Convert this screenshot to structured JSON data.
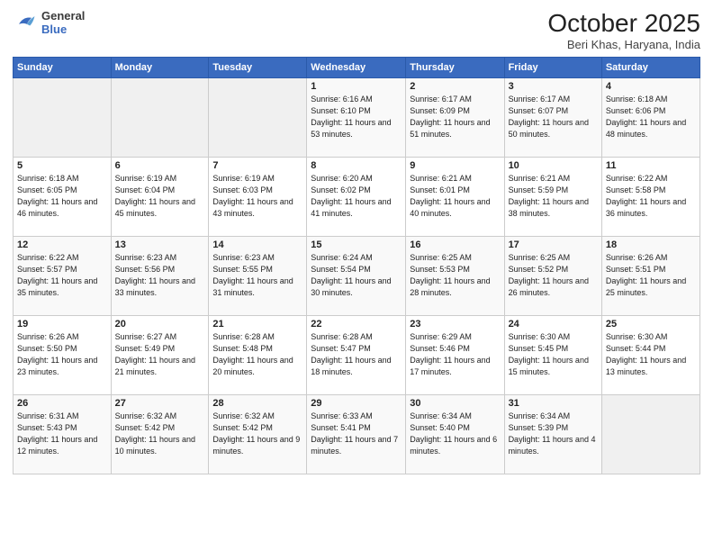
{
  "header": {
    "logo_line1": "General",
    "logo_line2": "Blue",
    "title": "October 2025",
    "location": "Beri Khas, Haryana, India"
  },
  "days": [
    "Sunday",
    "Monday",
    "Tuesday",
    "Wednesday",
    "Thursday",
    "Friday",
    "Saturday"
  ],
  "weeks": [
    [
      {
        "date": "",
        "sunrise": "",
        "sunset": "",
        "daylight": ""
      },
      {
        "date": "",
        "sunrise": "",
        "sunset": "",
        "daylight": ""
      },
      {
        "date": "",
        "sunrise": "",
        "sunset": "",
        "daylight": ""
      },
      {
        "date": "1",
        "sunrise": "Sunrise: 6:16 AM",
        "sunset": "Sunset: 6:10 PM",
        "daylight": "Daylight: 11 hours and 53 minutes."
      },
      {
        "date": "2",
        "sunrise": "Sunrise: 6:17 AM",
        "sunset": "Sunset: 6:09 PM",
        "daylight": "Daylight: 11 hours and 51 minutes."
      },
      {
        "date": "3",
        "sunrise": "Sunrise: 6:17 AM",
        "sunset": "Sunset: 6:07 PM",
        "daylight": "Daylight: 11 hours and 50 minutes."
      },
      {
        "date": "4",
        "sunrise": "Sunrise: 6:18 AM",
        "sunset": "Sunset: 6:06 PM",
        "daylight": "Daylight: 11 hours and 48 minutes."
      }
    ],
    [
      {
        "date": "5",
        "sunrise": "Sunrise: 6:18 AM",
        "sunset": "Sunset: 6:05 PM",
        "daylight": "Daylight: 11 hours and 46 minutes."
      },
      {
        "date": "6",
        "sunrise": "Sunrise: 6:19 AM",
        "sunset": "Sunset: 6:04 PM",
        "daylight": "Daylight: 11 hours and 45 minutes."
      },
      {
        "date": "7",
        "sunrise": "Sunrise: 6:19 AM",
        "sunset": "Sunset: 6:03 PM",
        "daylight": "Daylight: 11 hours and 43 minutes."
      },
      {
        "date": "8",
        "sunrise": "Sunrise: 6:20 AM",
        "sunset": "Sunset: 6:02 PM",
        "daylight": "Daylight: 11 hours and 41 minutes."
      },
      {
        "date": "9",
        "sunrise": "Sunrise: 6:21 AM",
        "sunset": "Sunset: 6:01 PM",
        "daylight": "Daylight: 11 hours and 40 minutes."
      },
      {
        "date": "10",
        "sunrise": "Sunrise: 6:21 AM",
        "sunset": "Sunset: 5:59 PM",
        "daylight": "Daylight: 11 hours and 38 minutes."
      },
      {
        "date": "11",
        "sunrise": "Sunrise: 6:22 AM",
        "sunset": "Sunset: 5:58 PM",
        "daylight": "Daylight: 11 hours and 36 minutes."
      }
    ],
    [
      {
        "date": "12",
        "sunrise": "Sunrise: 6:22 AM",
        "sunset": "Sunset: 5:57 PM",
        "daylight": "Daylight: 11 hours and 35 minutes."
      },
      {
        "date": "13",
        "sunrise": "Sunrise: 6:23 AM",
        "sunset": "Sunset: 5:56 PM",
        "daylight": "Daylight: 11 hours and 33 minutes."
      },
      {
        "date": "14",
        "sunrise": "Sunrise: 6:23 AM",
        "sunset": "Sunset: 5:55 PM",
        "daylight": "Daylight: 11 hours and 31 minutes."
      },
      {
        "date": "15",
        "sunrise": "Sunrise: 6:24 AM",
        "sunset": "Sunset: 5:54 PM",
        "daylight": "Daylight: 11 hours and 30 minutes."
      },
      {
        "date": "16",
        "sunrise": "Sunrise: 6:25 AM",
        "sunset": "Sunset: 5:53 PM",
        "daylight": "Daylight: 11 hours and 28 minutes."
      },
      {
        "date": "17",
        "sunrise": "Sunrise: 6:25 AM",
        "sunset": "Sunset: 5:52 PM",
        "daylight": "Daylight: 11 hours and 26 minutes."
      },
      {
        "date": "18",
        "sunrise": "Sunrise: 6:26 AM",
        "sunset": "Sunset: 5:51 PM",
        "daylight": "Daylight: 11 hours and 25 minutes."
      }
    ],
    [
      {
        "date": "19",
        "sunrise": "Sunrise: 6:26 AM",
        "sunset": "Sunset: 5:50 PM",
        "daylight": "Daylight: 11 hours and 23 minutes."
      },
      {
        "date": "20",
        "sunrise": "Sunrise: 6:27 AM",
        "sunset": "Sunset: 5:49 PM",
        "daylight": "Daylight: 11 hours and 21 minutes."
      },
      {
        "date": "21",
        "sunrise": "Sunrise: 6:28 AM",
        "sunset": "Sunset: 5:48 PM",
        "daylight": "Daylight: 11 hours and 20 minutes."
      },
      {
        "date": "22",
        "sunrise": "Sunrise: 6:28 AM",
        "sunset": "Sunset: 5:47 PM",
        "daylight": "Daylight: 11 hours and 18 minutes."
      },
      {
        "date": "23",
        "sunrise": "Sunrise: 6:29 AM",
        "sunset": "Sunset: 5:46 PM",
        "daylight": "Daylight: 11 hours and 17 minutes."
      },
      {
        "date": "24",
        "sunrise": "Sunrise: 6:30 AM",
        "sunset": "Sunset: 5:45 PM",
        "daylight": "Daylight: 11 hours and 15 minutes."
      },
      {
        "date": "25",
        "sunrise": "Sunrise: 6:30 AM",
        "sunset": "Sunset: 5:44 PM",
        "daylight": "Daylight: 11 hours and 13 minutes."
      }
    ],
    [
      {
        "date": "26",
        "sunrise": "Sunrise: 6:31 AM",
        "sunset": "Sunset: 5:43 PM",
        "daylight": "Daylight: 11 hours and 12 minutes."
      },
      {
        "date": "27",
        "sunrise": "Sunrise: 6:32 AM",
        "sunset": "Sunset: 5:42 PM",
        "daylight": "Daylight: 11 hours and 10 minutes."
      },
      {
        "date": "28",
        "sunrise": "Sunrise: 6:32 AM",
        "sunset": "Sunset: 5:42 PM",
        "daylight": "Daylight: 11 hours and 9 minutes."
      },
      {
        "date": "29",
        "sunrise": "Sunrise: 6:33 AM",
        "sunset": "Sunset: 5:41 PM",
        "daylight": "Daylight: 11 hours and 7 minutes."
      },
      {
        "date": "30",
        "sunrise": "Sunrise: 6:34 AM",
        "sunset": "Sunset: 5:40 PM",
        "daylight": "Daylight: 11 hours and 6 minutes."
      },
      {
        "date": "31",
        "sunrise": "Sunrise: 6:34 AM",
        "sunset": "Sunset: 5:39 PM",
        "daylight": "Daylight: 11 hours and 4 minutes."
      },
      {
        "date": "",
        "sunrise": "",
        "sunset": "",
        "daylight": ""
      }
    ]
  ]
}
